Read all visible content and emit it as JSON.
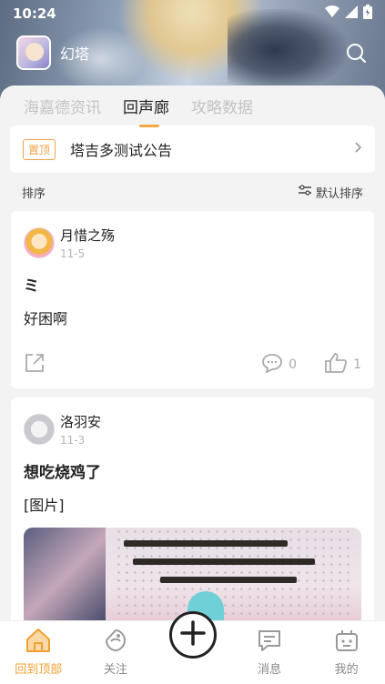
{
  "status": {
    "time": "10:24"
  },
  "app": {
    "name": "幻塔"
  },
  "tabs": [
    {
      "label": "海嘉德资讯"
    },
    {
      "label": "回声廊"
    },
    {
      "label": "攻略数据"
    }
  ],
  "pinned": {
    "badge": "置顶",
    "title": "塔吉多测试公告"
  },
  "sort": {
    "label": "排序",
    "button": "默认排序"
  },
  "posts": [
    {
      "user": "月惜之殇",
      "date": "11-5",
      "title": "ミ",
      "body": "好困啊",
      "comments": "0",
      "likes": "1"
    },
    {
      "user": "洛羽安",
      "date": "11-3",
      "title": "想吃烧鸡了",
      "body": "[图片]"
    }
  ],
  "nav": [
    {
      "label": "回到顶部"
    },
    {
      "label": "关注"
    },
    {
      "label": ""
    },
    {
      "label": "消息"
    },
    {
      "label": "我的"
    }
  ],
  "colors": {
    "accent": "#f0a030",
    "pin_badge": "#f0a34a"
  },
  "icons": [
    "wifi-icon",
    "signal-icon",
    "battery-icon",
    "search-icon",
    "sort-icon",
    "share-icon",
    "comment-icon",
    "like-icon",
    "home-icon",
    "follow-icon",
    "plus-icon",
    "message-icon",
    "profile-icon"
  ]
}
